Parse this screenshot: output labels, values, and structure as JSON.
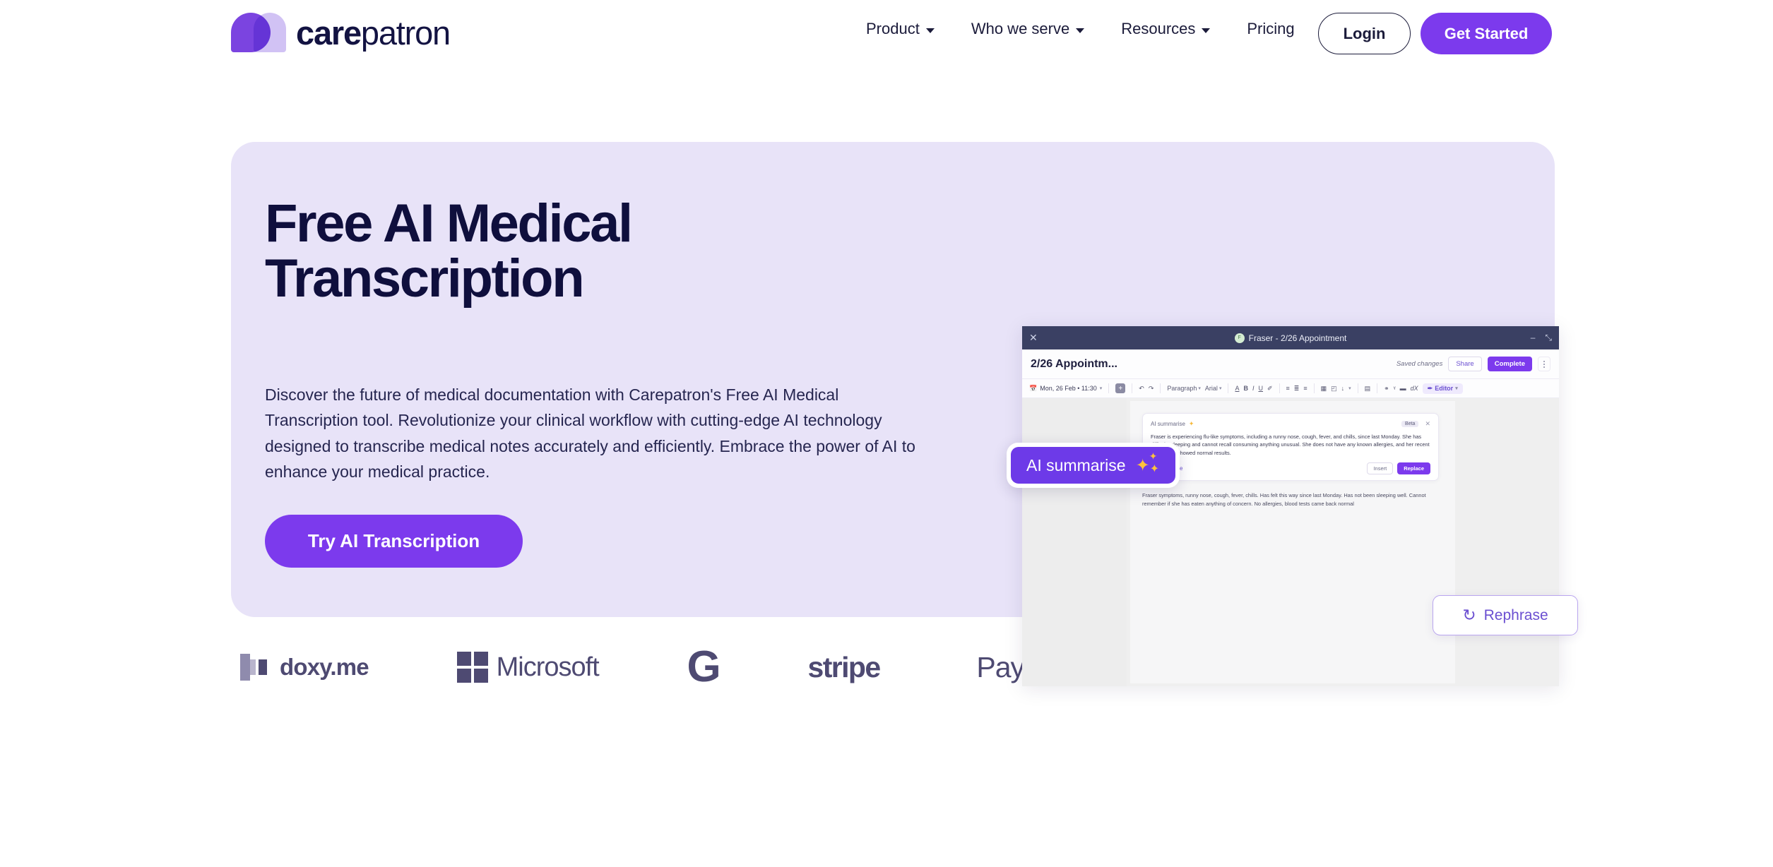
{
  "brand": {
    "name_bold": "care",
    "name_light": "patron",
    "accent": "#7c3aed",
    "hero_bg": "#e8e3f8",
    "ink": "#0f0f3d"
  },
  "nav": {
    "items": [
      {
        "label": "Product",
        "has_caret": true
      },
      {
        "label": "Who we serve",
        "has_caret": true
      },
      {
        "label": "Resources",
        "has_caret": true
      },
      {
        "label": "Pricing",
        "has_caret": false
      }
    ],
    "login_label": "Login",
    "get_started_label": "Get Started"
  },
  "hero": {
    "heading_line1": "Free AI Medical",
    "heading_line2": "Transcription",
    "paragraph": "Discover the future of medical documentation with Carepatron's Free AI Medical Transcription tool. Revolutionize your clinical workflow with cutting-edge AI technology designed to transcribe medical notes accurately and efficiently. Embrace the power of AI to enhance your medical practice.",
    "cta_label": "Try AI Transcription"
  },
  "logos": [
    {
      "name": "doxy.me",
      "text": "doxy.me"
    },
    {
      "name": "Microsoft",
      "text": "Microsoft"
    },
    {
      "name": "Google",
      "text": "G"
    },
    {
      "name": "stripe",
      "text": "stripe"
    },
    {
      "name": "Apple Pay",
      "apple_glyph": "",
      "text": "Pay"
    }
  ],
  "mockup": {
    "titlebar": {
      "close": "✕",
      "avatar_initial": "F",
      "title": "Fraser - 2/26 Appointment",
      "minimize": "–",
      "expand": "⤡"
    },
    "subbar": {
      "doc_name": "2/26 Appointm...",
      "saved_status": "Saved changes",
      "share_label": "Share",
      "complete_label": "Complete"
    },
    "toolbar": {
      "date": "Mon, 26 Feb • 11:30",
      "plus": "+",
      "undo": "↶",
      "redo": "↷",
      "paragraph": "Paragraph",
      "font": "Arial",
      "text_color": "A",
      "bold": "B",
      "italic": "I",
      "underline": "U",
      "highlight": "✐",
      "bullet_list": "≡",
      "number_list": "≣",
      "align": "≡",
      "table": "▦",
      "image": "◰",
      "mic": "↓",
      "more": "▾",
      "doc": "▤",
      "link_off": "⚭",
      "attach": "ᵞ",
      "tag": "▬",
      "clear_format": "dX",
      "editor_label": "Editor",
      "editor_pen": "✒"
    },
    "ai_card": {
      "label": "AI summarise",
      "sparkle": "✦",
      "badge": "Beta",
      "close": "✕",
      "summary": "Fraser is experiencing flu-like symptoms, including a runny nose, cough, fever, and chills, since last Monday. She has difficulty sleeping and cannot recall consuming anything unusual. She does not have any known allergies, and her recent blood tests showed normal results.",
      "rephrase_label": "Rephrase",
      "rephrase_icon": "↻",
      "insert_label": "Insert",
      "replace_label": "Replace"
    },
    "document_paragraph": "Fraser symptoms, runny nose, cough, fever, chills. Has felt this way since last Monday. Has not been sleeping well. Cannot remember if she has eaten anything of concern. No allergies, blood tests came back normal"
  },
  "overlays": {
    "ai_summarise_label": "AI summarise",
    "sparkle_big": "✦",
    "sparkle_small": "✦",
    "sparkle_mid": "✦",
    "rephrase_label": "Rephrase",
    "rephrase_icon": "↻"
  }
}
